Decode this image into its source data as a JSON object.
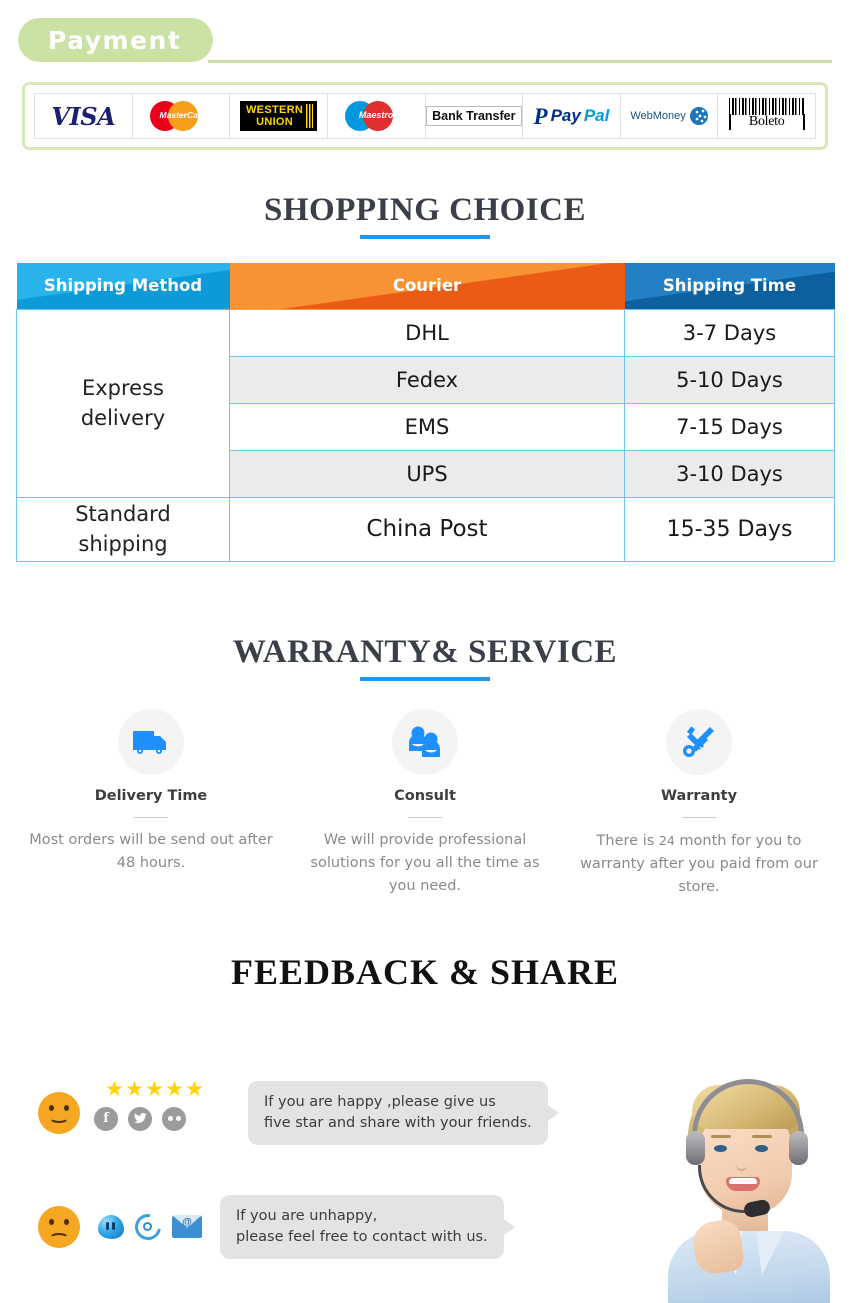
{
  "payment": {
    "heading": "Payment",
    "methods": [
      {
        "name": "visa",
        "label": "VISA"
      },
      {
        "name": "mastercard",
        "label": "MasterCard"
      },
      {
        "name": "western-union",
        "line1": "WESTERN",
        "line2": "UNION"
      },
      {
        "name": "maestro",
        "label": "Maestro"
      },
      {
        "name": "bank-transfer",
        "label": "Bank Transfer"
      },
      {
        "name": "paypal",
        "mark": "P",
        "label1": "Pay",
        "label2": "Pal"
      },
      {
        "name": "webmoney",
        "label": "WebMoney"
      },
      {
        "name": "boleto",
        "label": "Boleto"
      }
    ]
  },
  "shipping": {
    "title": "SHOPPING CHOICE",
    "columns": [
      "Shipping Method",
      "Courier",
      "Shipping Time"
    ],
    "rows": [
      {
        "method": "Express\ndelivery",
        "method_rowspan": 4,
        "courier": "DHL",
        "time": "3-7  Days",
        "shaded": false
      },
      {
        "courier": "Fedex",
        "time": "5-10 Days",
        "shaded": true
      },
      {
        "courier": "EMS",
        "time": "7-15 Days",
        "shaded": false
      },
      {
        "courier": "UPS",
        "time": "3-10 Days",
        "shaded": true
      },
      {
        "method": "Standard\nshipping",
        "method_rowspan": 1,
        "courier": "China Post",
        "time": "15-35 Days",
        "shaded": false
      }
    ]
  },
  "warranty": {
    "title": "WARRANTY& SERVICE",
    "items": [
      {
        "icon": "delivery-truck-icon",
        "label": "Delivery Time",
        "desc": "Most orders will be send out after 48 hours."
      },
      {
        "icon": "consult-people-icon",
        "label": "Consult",
        "desc": "We will provide professional solutions for you all the time as you need."
      },
      {
        "icon": "wrench-screwdriver-icon",
        "label": "Warranty",
        "desc_pre": "There is ",
        "desc_num": "24",
        "desc_post": " month for you to warranty after you paid from our store."
      }
    ]
  },
  "feedback": {
    "title": "FEEDBACK & SHARE",
    "happy": {
      "face": "smiley-happy-icon",
      "star_count": 5,
      "socials": [
        "facebook-icon",
        "twitter-icon",
        "flickr-icon"
      ],
      "message": "If you are happy ,please give us\nfive star and share with your friends."
    },
    "unhappy": {
      "face": "smiley-sad-icon",
      "contacts": [
        "msn-icon",
        "skype-icon",
        "email-icon"
      ],
      "message": "If you are unhappy,\nplease feel free to contact with us."
    },
    "agent_photo": "customer-service-agent-photo"
  },
  "colors": {
    "green_pill": "#cbe2a5",
    "accent_blue": "#2196f3",
    "header_blue": "#29b3ea",
    "header_orange": "#f79334",
    "header_blue_dark": "#2480c4",
    "star_yellow": "#ffd400",
    "face_orange": "#f5a623"
  }
}
